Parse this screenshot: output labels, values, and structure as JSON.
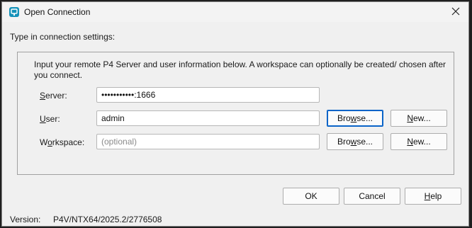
{
  "window": {
    "title": "Open Connection",
    "app_icon": "p4v-app-icon",
    "close_icon": "close-icon"
  },
  "section_label": "Type in connection settings:",
  "intro": "Input your remote P4 Server and user information below. A workspace can optionally be created/ chosen after you connect.",
  "server": {
    "label_u": "S",
    "label_rest": "erver:",
    "value": "•••••••••••:1666"
  },
  "user": {
    "label_u": "U",
    "label_rest": "ser:",
    "value": "admin",
    "browse_u": "w",
    "browse_pre": "Bro",
    "browse_post": "se...",
    "new_u": "N",
    "new_rest": "ew..."
  },
  "workspace": {
    "label_pre": "W",
    "label_u": "o",
    "label_rest": "rkspace:",
    "placeholder": "(optional)",
    "browse_u": "w",
    "browse_pre": "Bro",
    "browse_post": "se...",
    "new_u": "N",
    "new_rest": "ew..."
  },
  "buttons": {
    "ok": "OK",
    "cancel": "Cancel",
    "help_u": "H",
    "help_rest": "elp"
  },
  "version": {
    "label": "Version:",
    "value": "P4V/NTX64/2025.2/2776508"
  },
  "colors": {
    "accent": "#0a64c8",
    "dialog_bg": "#f0f0f0",
    "icon_teal": "#1592b9"
  }
}
